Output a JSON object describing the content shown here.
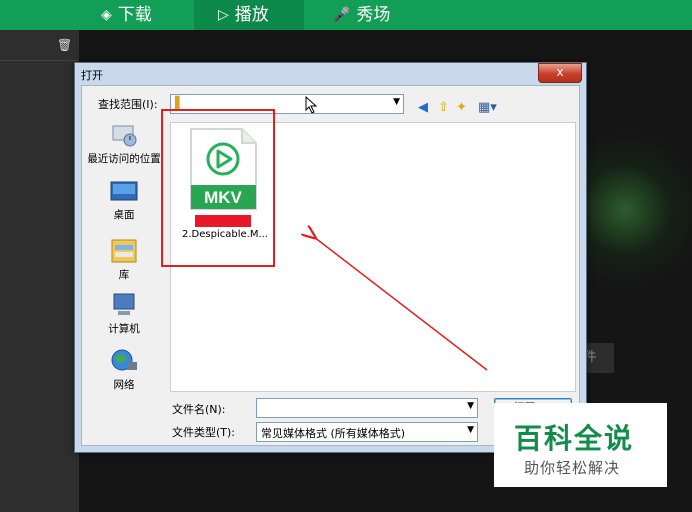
{
  "topbar": {
    "tabs": [
      {
        "label": "下载",
        "icon": "layers-icon"
      },
      {
        "label": "播放",
        "icon": "play-icon"
      },
      {
        "label": "秀场",
        "icon": "microphone-icon"
      }
    ]
  },
  "background": {
    "button_partial": "件"
  },
  "dialog": {
    "title": "打开",
    "close": "x",
    "lookin_label": "查找范围(I):",
    "places": [
      {
        "label": "最近访问的位置",
        "icon": "recent-places-icon"
      },
      {
        "label": "桌面",
        "icon": "desktop-icon"
      },
      {
        "label": "库",
        "icon": "library-icon"
      },
      {
        "label": "计算机",
        "icon": "computer-icon"
      },
      {
        "label": "网络",
        "icon": "network-icon"
      }
    ],
    "file": {
      "name": "2.Despicable.M...",
      "badge": "MKV"
    },
    "filename_label": "文件名(N):",
    "filename_value": "",
    "filetype_label": "文件类型(T):",
    "filetype_value": "常见媒体格式 (所有媒体格式)",
    "open_button": "打开(O)"
  },
  "watermark": {
    "title": "百科全说",
    "subtitle": "助你轻松解决"
  },
  "colors": {
    "accent": "#139e55",
    "annotation": "#e02020"
  }
}
